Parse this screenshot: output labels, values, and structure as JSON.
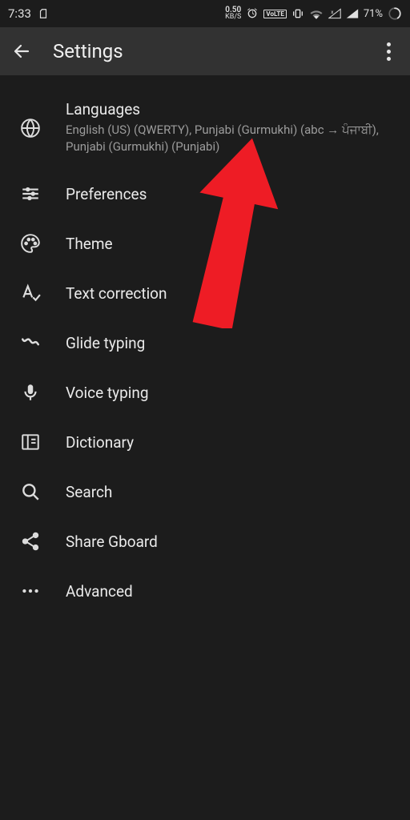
{
  "status": {
    "time": "7:33",
    "kbs_value": "0.50",
    "kbs_label": "KB/S",
    "volte": "VoLTE",
    "battery": "71%"
  },
  "header": {
    "title": "Settings"
  },
  "items": [
    {
      "label": "Languages",
      "sub": "English (US) (QWERTY), Punjabi (Gurmukhi) (abc → ਪੰਜਾਬੀ), Punjabi (Gurmukhi) (Punjabi)",
      "icon": "globe-icon"
    },
    {
      "label": "Preferences",
      "icon": "sliders-icon"
    },
    {
      "label": "Theme",
      "icon": "palette-icon"
    },
    {
      "label": "Text correction",
      "icon": "text-correction-icon"
    },
    {
      "label": "Glide typing",
      "icon": "glide-icon"
    },
    {
      "label": "Voice typing",
      "icon": "mic-icon"
    },
    {
      "label": "Dictionary",
      "icon": "dictionary-icon"
    },
    {
      "label": "Search",
      "icon": "search-icon"
    },
    {
      "label": "Share Gboard",
      "icon": "share-icon"
    },
    {
      "label": "Advanced",
      "icon": "more-icon"
    }
  ]
}
